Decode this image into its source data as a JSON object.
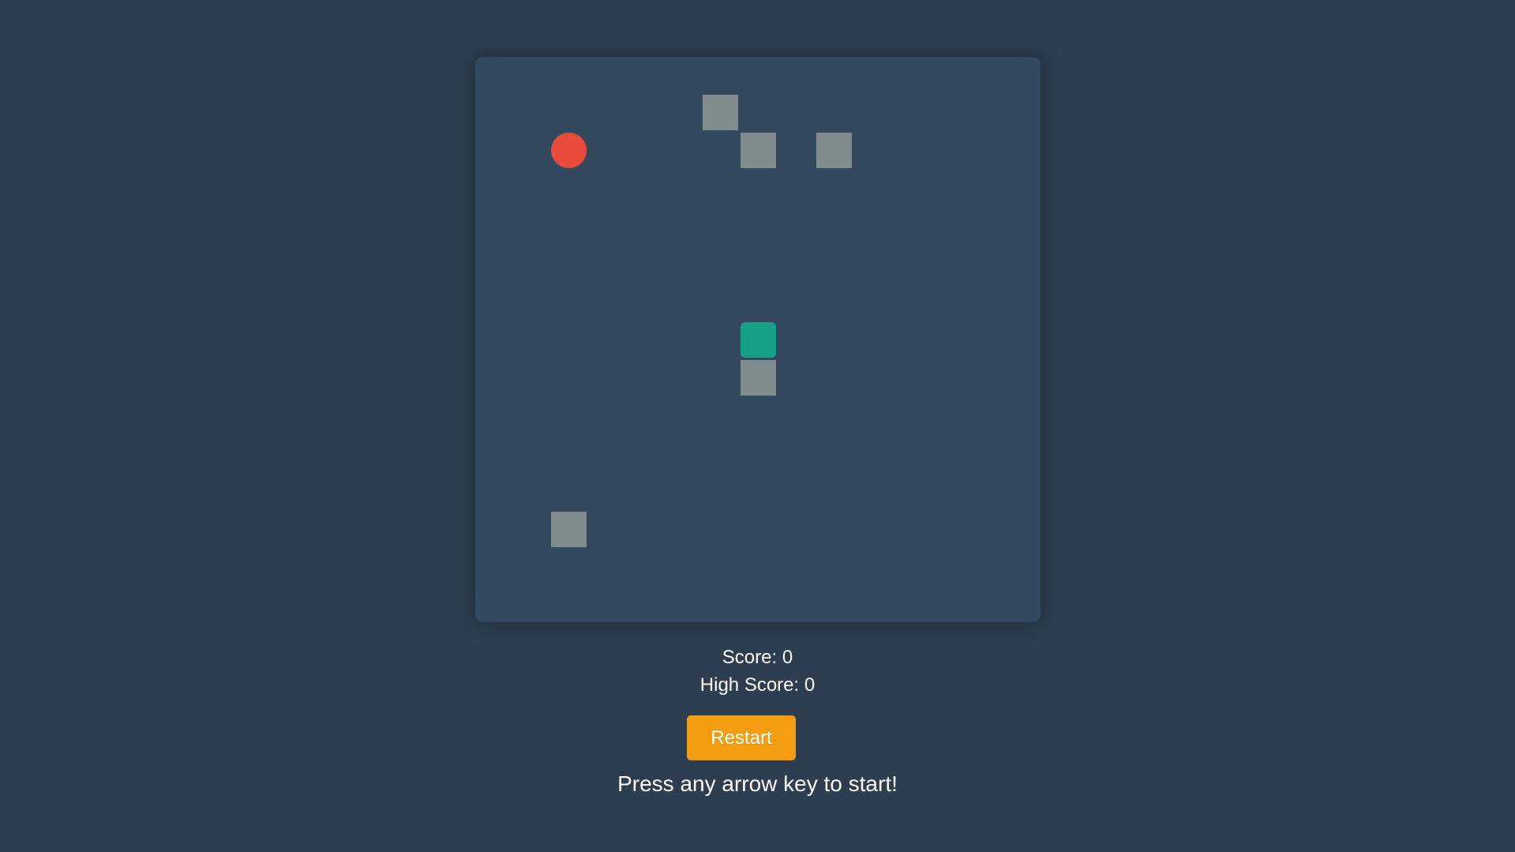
{
  "colors": {
    "background": "#2c3e50",
    "board": "#34495e",
    "obstacle": "#7f8c8d",
    "snake_head": "#16a085",
    "snake_body": "#7f8c8d",
    "food": "#e74c3c",
    "button": "#f39c12"
  },
  "game": {
    "grid_size": 15,
    "food": {
      "col": 2,
      "row": 2
    },
    "snake": [
      {
        "col": 7,
        "row": 7,
        "part": "head"
      },
      {
        "col": 7,
        "row": 8,
        "part": "body"
      }
    ],
    "obstacles": [
      {
        "col": 6,
        "row": 1
      },
      {
        "col": 7,
        "row": 2
      },
      {
        "col": 9,
        "row": 2
      },
      {
        "col": 2,
        "row": 12
      }
    ]
  },
  "score": {
    "score_text": "Score: 0",
    "high_score_text": "High Score: 0"
  },
  "controls": {
    "restart_label": "Restart"
  },
  "message": "Press any arrow key to start!"
}
